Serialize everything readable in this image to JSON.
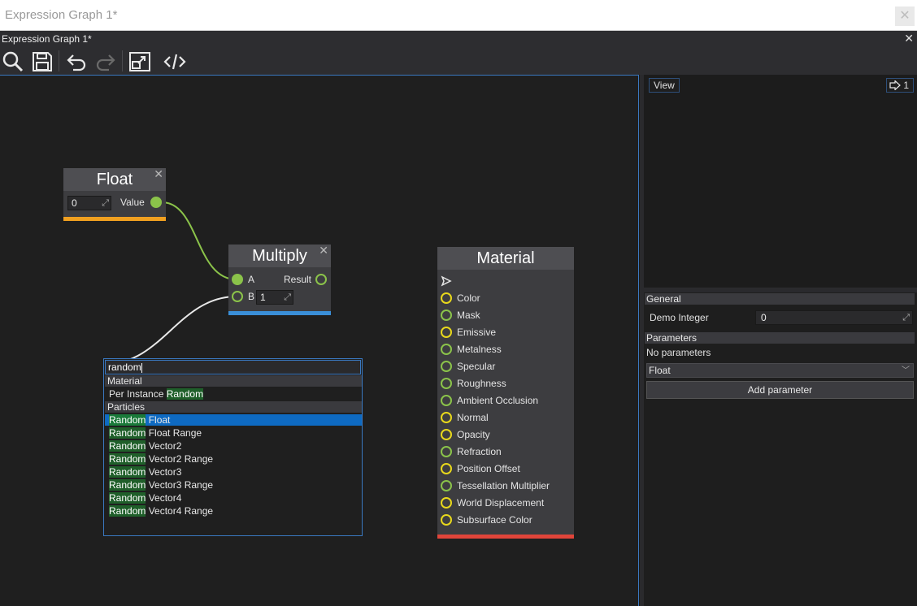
{
  "window": {
    "title": "Expression Graph 1*",
    "close_glyph": "✕"
  },
  "tab": {
    "title": "Expression Graph 1*",
    "close_glyph": "✕"
  },
  "toolbar": {
    "buttons": [
      "search-icon",
      "save-icon",
      "undo-icon",
      "redo-icon",
      "show-whole-graph-icon",
      "show-source-code-icon"
    ]
  },
  "nodes": {
    "float": {
      "title": "Float",
      "value": "0",
      "output_label": "Value",
      "bar_color": "#f0a020"
    },
    "multiply": {
      "title": "Multiply",
      "input_a": "A",
      "input_b": "B",
      "b_value": "1",
      "output_label": "Result",
      "bar_color": "#3a8fd8"
    },
    "material": {
      "title": "Material",
      "bar_color": "#e0453a",
      "inputs": [
        {
          "label": "Color",
          "type": "yellow"
        },
        {
          "label": "Mask",
          "type": "green"
        },
        {
          "label": "Emissive",
          "type": "yellow"
        },
        {
          "label": "Metalness",
          "type": "green"
        },
        {
          "label": "Specular",
          "type": "green"
        },
        {
          "label": "Roughness",
          "type": "green"
        },
        {
          "label": "Ambient Occlusion",
          "type": "green"
        },
        {
          "label": "Normal",
          "type": "yellow"
        },
        {
          "label": "Opacity",
          "type": "yellow"
        },
        {
          "label": "Refraction",
          "type": "green"
        },
        {
          "label": "Position Offset",
          "type": "yellow"
        },
        {
          "label": "Tessellation Multiplier",
          "type": "green"
        },
        {
          "label": "World Displacement",
          "type": "yellow"
        },
        {
          "label": "Subsurface Color",
          "type": "yellow"
        }
      ]
    }
  },
  "search_popup": {
    "query": "random",
    "groups": [
      {
        "name": "Material",
        "items": [
          {
            "prefix": "Per Instance ",
            "match": "Random",
            "suffix": ""
          }
        ]
      },
      {
        "name": "Particles",
        "items": [
          {
            "prefix": "",
            "match": "Random",
            "suffix": " Float",
            "selected": true
          },
          {
            "prefix": "",
            "match": "Random",
            "suffix": " Float Range"
          },
          {
            "prefix": "",
            "match": "Random",
            "suffix": " Vector2"
          },
          {
            "prefix": "",
            "match": "Random",
            "suffix": " Vector2 Range"
          },
          {
            "prefix": "",
            "match": "Random",
            "suffix": " Vector3"
          },
          {
            "prefix": "",
            "match": "Random",
            "suffix": " Vector3 Range"
          },
          {
            "prefix": "",
            "match": "Random",
            "suffix": " Vector4"
          },
          {
            "prefix": "",
            "match": "Random",
            "suffix": " Vector4 Range"
          }
        ]
      }
    ]
  },
  "right_panel": {
    "view_button": "View",
    "counter": "1",
    "general_header": "General",
    "demo_integer_label": "Demo Integer",
    "demo_integer_value": "0",
    "parameters_header": "Parameters",
    "no_parameters": "No parameters",
    "type_dropdown": "Float",
    "add_parameter": "Add parameter"
  }
}
